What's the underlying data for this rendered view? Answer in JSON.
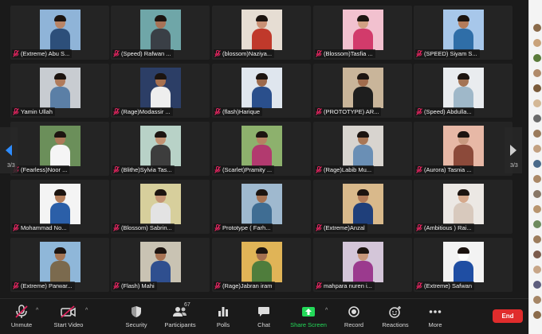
{
  "participants": [
    {
      "name": "(Extreme) Abu S...",
      "bg": "#8fb4d8",
      "body": "#2d4f7a",
      "head": "#b98465"
    },
    {
      "name": "(Speed) Rafwan ...",
      "bg": "#6fa6a8",
      "body": "#3a3f46",
      "head": "#a77256"
    },
    {
      "name": "(blossom)Naziya...",
      "bg": "#e6ddd3",
      "body": "#c0392b",
      "head": "#c99175"
    },
    {
      "name": "(Blossom)Tasfia ...",
      "bg": "#f2c1cf",
      "body": "#d23b6b",
      "head": "#d1a083"
    },
    {
      "name": "(SPEED) Siyam S...",
      "bg": "#a7c7ea",
      "body": "#2f6ea8",
      "head": "#b47b5a"
    },
    {
      "name": "Yamin Ullah",
      "bg": "#c8ccd1",
      "body": "#5b7fa6",
      "head": "#b07b5b"
    },
    {
      "name": "(Rage)Modassir ...",
      "bg": "#2c3e66",
      "body": "#eeeeee",
      "head": "#a8714f"
    },
    {
      "name": "(flash)Harique",
      "bg": "#dfe6ee",
      "body": "#2a4f8c",
      "head": "#9d6a4c"
    },
    {
      "name": "(PROTOTYPE) AR...",
      "bg": "#c9b59a",
      "body": "#1e1e1e",
      "head": "#a06c4d"
    },
    {
      "name": "(Speed) Abdulla...",
      "bg": "#e9ecef",
      "body": "#9fb8c9",
      "head": "#a47455"
    },
    {
      "name": "(Fearless)Noor ...",
      "bg": "#6b8f5a",
      "body": "#f5f5f5",
      "head": "#ad7a59"
    },
    {
      "name": "(Blithe)Sylvia Tas...",
      "bg": "#b8d2c7",
      "body": "#3d3d3d",
      "head": "#c29272"
    },
    {
      "name": "(Scarlet)Pramity ...",
      "bg": "#8db16d",
      "body": "#b23a6f",
      "head": "#b58262"
    },
    {
      "name": "(Rage)Labib Mu...",
      "bg": "#d8d4cf",
      "body": "#6a8fb5",
      "head": "#a97756"
    },
    {
      "name": "(Aurora) Tasnia ...",
      "bg": "#e7b8a6",
      "body": "#8c4a3a",
      "head": "#c99a80"
    },
    {
      "name": "Mohammad No...",
      "bg": "#f4f4f4",
      "body": "#2b5fa8",
      "head": "#b37e5c"
    },
    {
      "name": "(Blossom) Sabrin...",
      "bg": "#d7cf9c",
      "body": "#e3e3e3",
      "head": "#c49474"
    },
    {
      "name": "Prototype ( Farh...",
      "bg": "#9fb9cf",
      "body": "#3f6d93",
      "head": "#a67353"
    },
    {
      "name": "(Extreme)Anzal",
      "bg": "#d9b98b",
      "body": "#1f3f7a",
      "head": "#b07a58"
    },
    {
      "name": "(Ambitious ) Rai...",
      "bg": "#ece8e4",
      "body": "#d8c9bd",
      "head": "#d5a88b"
    },
    {
      "name": "(Extreme) Parwar...",
      "bg": "#8fb7d9",
      "body": "#7b6a4e",
      "head": "#a67655"
    },
    {
      "name": "(Flash)  Mahi",
      "bg": "#c9c3b3",
      "body": "#2f4f8f",
      "head": "#a87353"
    },
    {
      "name": "(Rage)Jabran iram",
      "bg": "#e0b457",
      "body": "#4f7d3c",
      "head": "#a46f50"
    },
    {
      "name": "mahpara nuren i...",
      "bg": "#d4c6d9",
      "body": "#9b3a8e",
      "head": "#c8977a"
    },
    {
      "name": "(Extreme) Safwan",
      "bg": "#f3f3f3",
      "body": "#1f4ea3",
      "head": "#ffffff"
    }
  ],
  "pagination": {
    "left": "3/3",
    "right": "3/3"
  },
  "toolbar": {
    "unmute": "Unmute",
    "start_video": "Start Video",
    "security": "Security",
    "participants": "Participants",
    "participant_count": "67",
    "polls": "Polls",
    "chat": "Chat",
    "share_screen": "Share Screen",
    "record": "Record",
    "reactions": "Reactions",
    "more": "More",
    "end": "End"
  },
  "colors": {
    "accent_blue": "#2d8cff",
    "share_green": "#23d959",
    "end_red": "#e02c2c",
    "muted_red": "#e0245e"
  },
  "sidebar_avatars": [
    "#8a6a4a",
    "#c9a27a",
    "#5a7a3a",
    "#b08a6a",
    "#7a5a3a",
    "#d4b896",
    "#6a6a6a",
    "#9a7a5a",
    "#c2a080",
    "#4a6a8a",
    "#aa8866",
    "#887766",
    "#b8956f",
    "#6d8a5d",
    "#9c7c5c",
    "#7b5b4b",
    "#c7a587",
    "#5d5d7d",
    "#a58565",
    "#8b6b4b"
  ]
}
